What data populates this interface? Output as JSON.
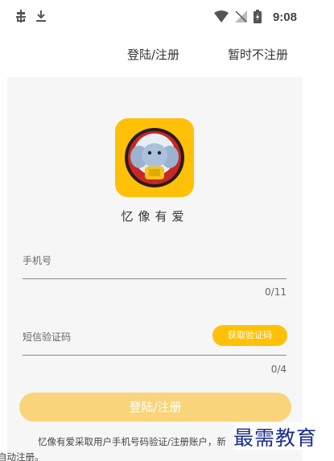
{
  "status_bar": {
    "time": "9:08",
    "left_icons": [
      "bug-icon",
      "download-icon"
    ],
    "right_icons": [
      "wifi-icon",
      "no-signal-icon",
      "battery-icon"
    ]
  },
  "top_nav": {
    "login_register": "登陆/注册",
    "skip_register": "暂时不注册"
  },
  "app": {
    "name": "忆像有爱",
    "logo_icon": "elephant-logo-icon"
  },
  "form": {
    "phone_placeholder": "手机号",
    "phone_counter": "0/11",
    "sms_placeholder": "短信验证码",
    "get_code_label": "获取验证码",
    "sms_counter": "0/4",
    "submit_label": "登陆/注册"
  },
  "notice": "忆像有爱采取用户手机号码验证/注册账户，新",
  "notice_tail": "自动注册。",
  "watermark": "最需教育",
  "colors": {
    "accent": "#ffc107",
    "submit_disabled": "#fad47a",
    "card_bg": "#f6f6f6"
  }
}
